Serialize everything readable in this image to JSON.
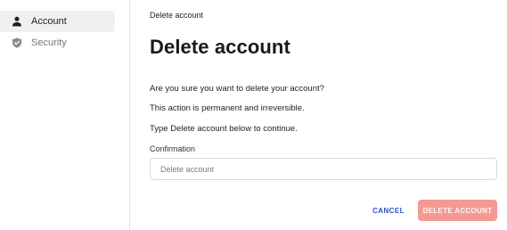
{
  "sidebar": {
    "items": [
      {
        "label": "Account",
        "icon": "person-icon",
        "active": true
      },
      {
        "label": "Security",
        "icon": "shield-icon",
        "active": false
      }
    ]
  },
  "main": {
    "breadcrumb": "Delete account",
    "title": "Delete account",
    "paragraphs": [
      "Are you sure you want to delete your account?",
      "This action is permanent and irreversible.",
      "Type Delete account below to continue."
    ],
    "confirmation": {
      "label": "Confirmation",
      "placeholder": "Delete account",
      "value": ""
    },
    "buttons": {
      "cancel_label": "CANCEL",
      "delete_label": "DELETE ACCOUNT",
      "delete_disabled": true
    }
  },
  "colors": {
    "accent": "#2c4fc9",
    "danger_disabled": "#f49a94",
    "active_nav_bg": "#f0f0f0"
  }
}
